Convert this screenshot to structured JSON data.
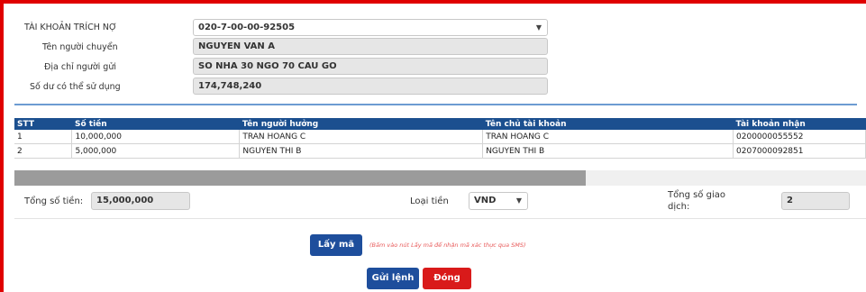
{
  "form": {
    "debit_account_label": "TÀI KHOẢN TRÍCH NỢ",
    "debit_account_value": "020-7-00-00-92505",
    "sender_name_label": "Tên người chuyển",
    "sender_name_value": "NGUYEN VAN A",
    "sender_address_label": "Địa chỉ người gửi",
    "sender_address_value": "SO NHA 30 NGO 70 CAU GO",
    "balance_label": "Số dư có thể sử dụng",
    "balance_value": "174,748,240"
  },
  "table": {
    "headers": [
      "STT",
      "Số tiền",
      "Tên người hưởng",
      "Tên chủ tài khoản",
      "Tài khoản nhận"
    ],
    "rows": [
      [
        "1",
        "10,000,000",
        "TRAN HOANG C",
        "TRAN HOANG C",
        "0200000055552"
      ],
      [
        "2",
        "5,000,000",
        "NGUYEN THI B",
        "NGUYEN THI B",
        "0207000092851"
      ]
    ]
  },
  "summary": {
    "total_amount_label": "Tổng số tiền:",
    "total_amount_value": "15,000,000",
    "currency_label": "Loại tiền",
    "currency_value": "VND",
    "total_tx_label_1": "Tổng số giao",
    "total_tx_label_2": "dịch:",
    "total_tx_value": "2"
  },
  "actions": {
    "get_code_label": "Lấy mã",
    "get_code_note": "(Bấm vào nút Lấy mã để nhận mã xác thực qua SMS)",
    "submit_label": "Gửi lệnh",
    "close_label": "Đóng"
  },
  "colors": {
    "accent_red": "#e00000",
    "header_blue": "#1b4f8f",
    "button_blue": "#1e4e9c",
    "button_red": "#d91a1a"
  },
  "icons": [
    "dropdown-arrow-icon"
  ]
}
